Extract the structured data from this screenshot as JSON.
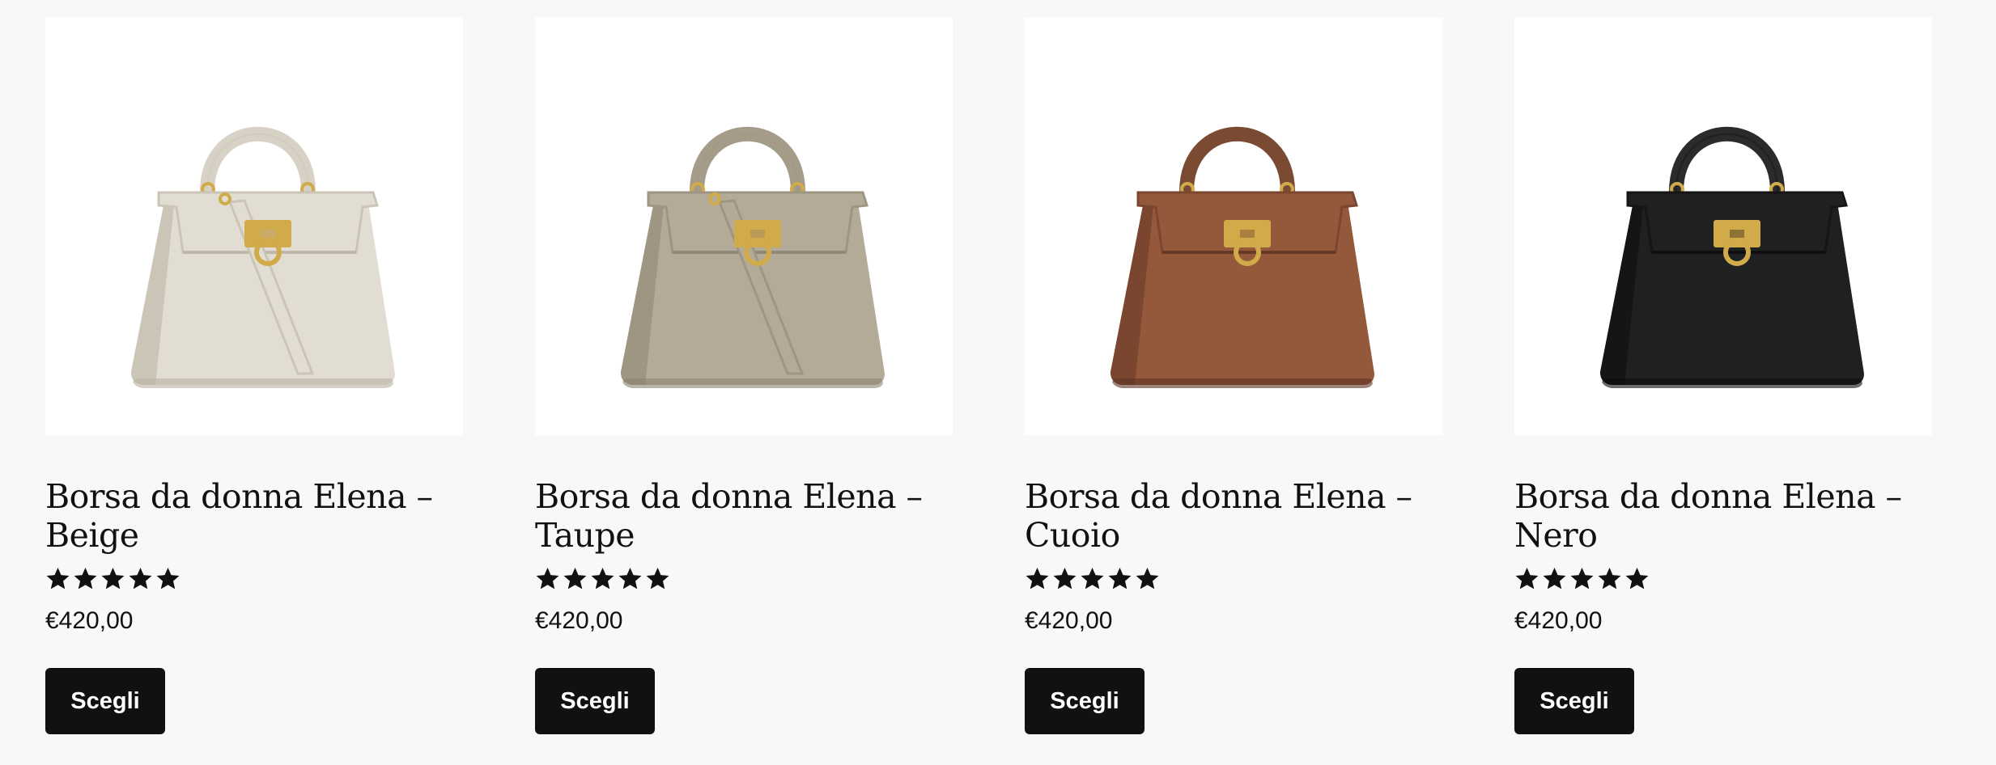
{
  "products": [
    {
      "title": "Borsa da donna Elena – Beige",
      "rating": 5,
      "price": "€420,00",
      "button": "Scegli",
      "colors": {
        "body": "#e2ddd2",
        "shade": "#cbc5b8",
        "dark": "#b9b2a4",
        "handle": "#d8d2c6"
      },
      "has_strap": true
    },
    {
      "title": "Borsa da donna Elena – Taupe",
      "rating": 5,
      "price": "€420,00",
      "button": "Scegli",
      "colors": {
        "body": "#b4aa98",
        "shade": "#9f9583",
        "dark": "#8b826f",
        "handle": "#a59b89"
      },
      "has_strap": true
    },
    {
      "title": "Borsa da donna Elena – Cuoio",
      "rating": 5,
      "price": "€420,00",
      "button": "Scegli",
      "colors": {
        "body": "#94593a",
        "shade": "#7b4630",
        "dark": "#5e3424",
        "handle": "#7a4a33"
      },
      "has_strap": false
    },
    {
      "title": "Borsa da donna Elena – Nero",
      "rating": 5,
      "price": "€420,00",
      "button": "Scegli",
      "colors": {
        "body": "#1f2022",
        "shade": "#141517",
        "dark": "#0c0c0d",
        "handle": "#2a2b2d"
      },
      "has_strap": false
    }
  ],
  "hardware_color": "#d1aa4a",
  "star_color": "#111111"
}
